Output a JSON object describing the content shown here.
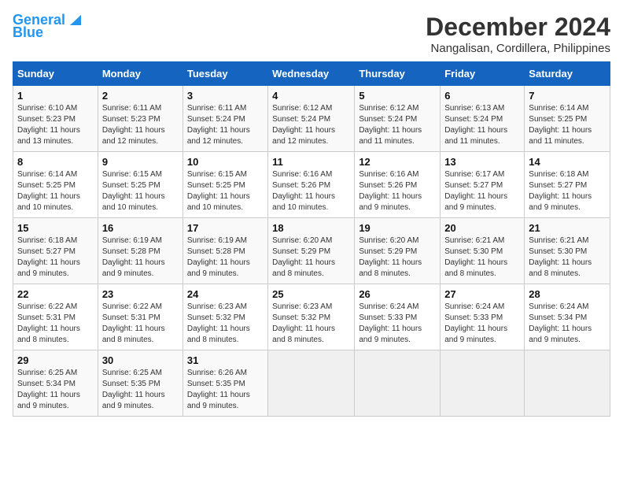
{
  "logo": {
    "line1": "General",
    "line2": "Blue"
  },
  "title": "December 2024",
  "location": "Nangalisan, Cordillera, Philippines",
  "days_of_week": [
    "Sunday",
    "Monday",
    "Tuesday",
    "Wednesday",
    "Thursday",
    "Friday",
    "Saturday"
  ],
  "weeks": [
    [
      {
        "day": "1",
        "info": "Sunrise: 6:10 AM\nSunset: 5:23 PM\nDaylight: 11 hours\nand 13 minutes."
      },
      {
        "day": "2",
        "info": "Sunrise: 6:11 AM\nSunset: 5:23 PM\nDaylight: 11 hours\nand 12 minutes."
      },
      {
        "day": "3",
        "info": "Sunrise: 6:11 AM\nSunset: 5:24 PM\nDaylight: 11 hours\nand 12 minutes."
      },
      {
        "day": "4",
        "info": "Sunrise: 6:12 AM\nSunset: 5:24 PM\nDaylight: 11 hours\nand 12 minutes."
      },
      {
        "day": "5",
        "info": "Sunrise: 6:12 AM\nSunset: 5:24 PM\nDaylight: 11 hours\nand 11 minutes."
      },
      {
        "day": "6",
        "info": "Sunrise: 6:13 AM\nSunset: 5:24 PM\nDaylight: 11 hours\nand 11 minutes."
      },
      {
        "day": "7",
        "info": "Sunrise: 6:14 AM\nSunset: 5:25 PM\nDaylight: 11 hours\nand 11 minutes."
      }
    ],
    [
      {
        "day": "8",
        "info": "Sunrise: 6:14 AM\nSunset: 5:25 PM\nDaylight: 11 hours\nand 10 minutes."
      },
      {
        "day": "9",
        "info": "Sunrise: 6:15 AM\nSunset: 5:25 PM\nDaylight: 11 hours\nand 10 minutes."
      },
      {
        "day": "10",
        "info": "Sunrise: 6:15 AM\nSunset: 5:25 PM\nDaylight: 11 hours\nand 10 minutes."
      },
      {
        "day": "11",
        "info": "Sunrise: 6:16 AM\nSunset: 5:26 PM\nDaylight: 11 hours\nand 10 minutes."
      },
      {
        "day": "12",
        "info": "Sunrise: 6:16 AM\nSunset: 5:26 PM\nDaylight: 11 hours\nand 9 minutes."
      },
      {
        "day": "13",
        "info": "Sunrise: 6:17 AM\nSunset: 5:27 PM\nDaylight: 11 hours\nand 9 minutes."
      },
      {
        "day": "14",
        "info": "Sunrise: 6:18 AM\nSunset: 5:27 PM\nDaylight: 11 hours\nand 9 minutes."
      }
    ],
    [
      {
        "day": "15",
        "info": "Sunrise: 6:18 AM\nSunset: 5:27 PM\nDaylight: 11 hours\nand 9 minutes."
      },
      {
        "day": "16",
        "info": "Sunrise: 6:19 AM\nSunset: 5:28 PM\nDaylight: 11 hours\nand 9 minutes."
      },
      {
        "day": "17",
        "info": "Sunrise: 6:19 AM\nSunset: 5:28 PM\nDaylight: 11 hours\nand 9 minutes."
      },
      {
        "day": "18",
        "info": "Sunrise: 6:20 AM\nSunset: 5:29 PM\nDaylight: 11 hours\nand 8 minutes."
      },
      {
        "day": "19",
        "info": "Sunrise: 6:20 AM\nSunset: 5:29 PM\nDaylight: 11 hours\nand 8 minutes."
      },
      {
        "day": "20",
        "info": "Sunrise: 6:21 AM\nSunset: 5:30 PM\nDaylight: 11 hours\nand 8 minutes."
      },
      {
        "day": "21",
        "info": "Sunrise: 6:21 AM\nSunset: 5:30 PM\nDaylight: 11 hours\nand 8 minutes."
      }
    ],
    [
      {
        "day": "22",
        "info": "Sunrise: 6:22 AM\nSunset: 5:31 PM\nDaylight: 11 hours\nand 8 minutes."
      },
      {
        "day": "23",
        "info": "Sunrise: 6:22 AM\nSunset: 5:31 PM\nDaylight: 11 hours\nand 8 minutes."
      },
      {
        "day": "24",
        "info": "Sunrise: 6:23 AM\nSunset: 5:32 PM\nDaylight: 11 hours\nand 8 minutes."
      },
      {
        "day": "25",
        "info": "Sunrise: 6:23 AM\nSunset: 5:32 PM\nDaylight: 11 hours\nand 8 minutes."
      },
      {
        "day": "26",
        "info": "Sunrise: 6:24 AM\nSunset: 5:33 PM\nDaylight: 11 hours\nand 9 minutes."
      },
      {
        "day": "27",
        "info": "Sunrise: 6:24 AM\nSunset: 5:33 PM\nDaylight: 11 hours\nand 9 minutes."
      },
      {
        "day": "28",
        "info": "Sunrise: 6:24 AM\nSunset: 5:34 PM\nDaylight: 11 hours\nand 9 minutes."
      }
    ],
    [
      {
        "day": "29",
        "info": "Sunrise: 6:25 AM\nSunset: 5:34 PM\nDaylight: 11 hours\nand 9 minutes."
      },
      {
        "day": "30",
        "info": "Sunrise: 6:25 AM\nSunset: 5:35 PM\nDaylight: 11 hours\nand 9 minutes."
      },
      {
        "day": "31",
        "info": "Sunrise: 6:26 AM\nSunset: 5:35 PM\nDaylight: 11 hours\nand 9 minutes."
      },
      {
        "day": "",
        "info": ""
      },
      {
        "day": "",
        "info": ""
      },
      {
        "day": "",
        "info": ""
      },
      {
        "day": "",
        "info": ""
      }
    ]
  ]
}
